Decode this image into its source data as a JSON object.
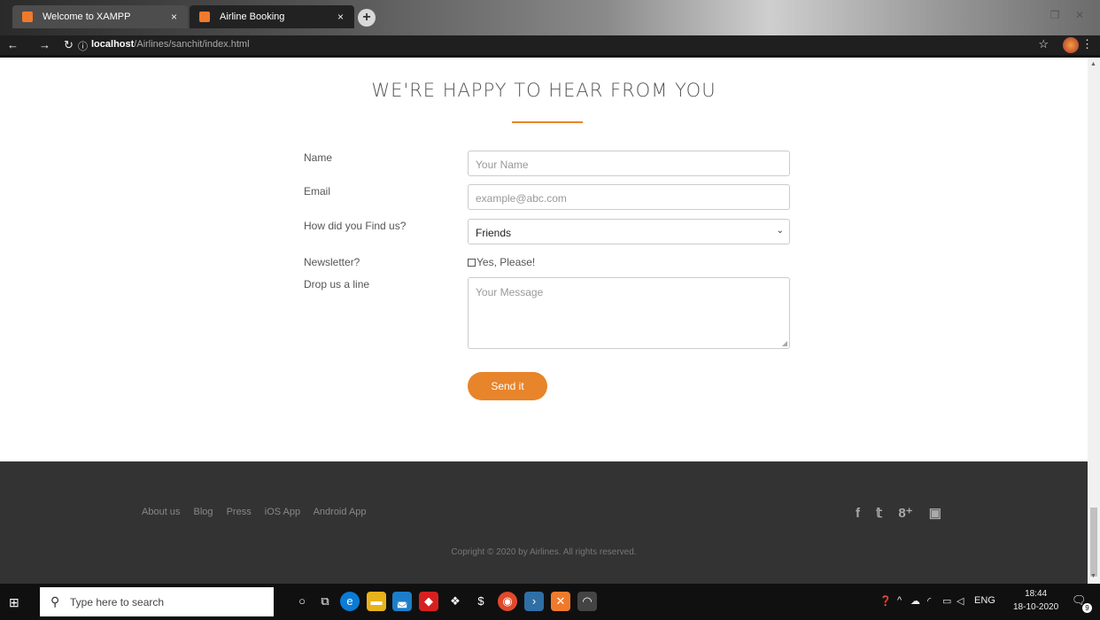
{
  "browser": {
    "tabs": [
      {
        "title": "Welcome to XAMPP",
        "close": "×"
      },
      {
        "title": "Airline Booking",
        "close": "×"
      }
    ],
    "new_tab": "+",
    "url_host": "localhost",
    "url_path": "/Airlines/sanchit/index.html"
  },
  "page": {
    "heading": "WE'RE HAPPY TO HEAR FROM YOU",
    "form": {
      "name_label": "Name",
      "name_placeholder": "Your Name",
      "email_label": "Email",
      "email_placeholder": "example@abc.com",
      "find_label": "How did you Find us?",
      "find_value": "Friends",
      "newsletter_label": "Newsletter?",
      "newsletter_option": "Yes, Please!",
      "message_label": "Drop us a line",
      "message_placeholder": "Your Message",
      "submit": "Send it"
    }
  },
  "footer": {
    "links": [
      "About us",
      "Blog",
      "Press",
      "iOS App",
      "Android App"
    ],
    "social": [
      "f",
      "𝕥",
      "8⁺",
      "▣"
    ],
    "copyright": "Copright © 2020 by Airlines. All rights reserved."
  },
  "taskbar": {
    "search_placeholder": "Type here to search",
    "lang": "ENG",
    "time": "18:44",
    "date": "18-10-2020",
    "notif_count": "9"
  }
}
